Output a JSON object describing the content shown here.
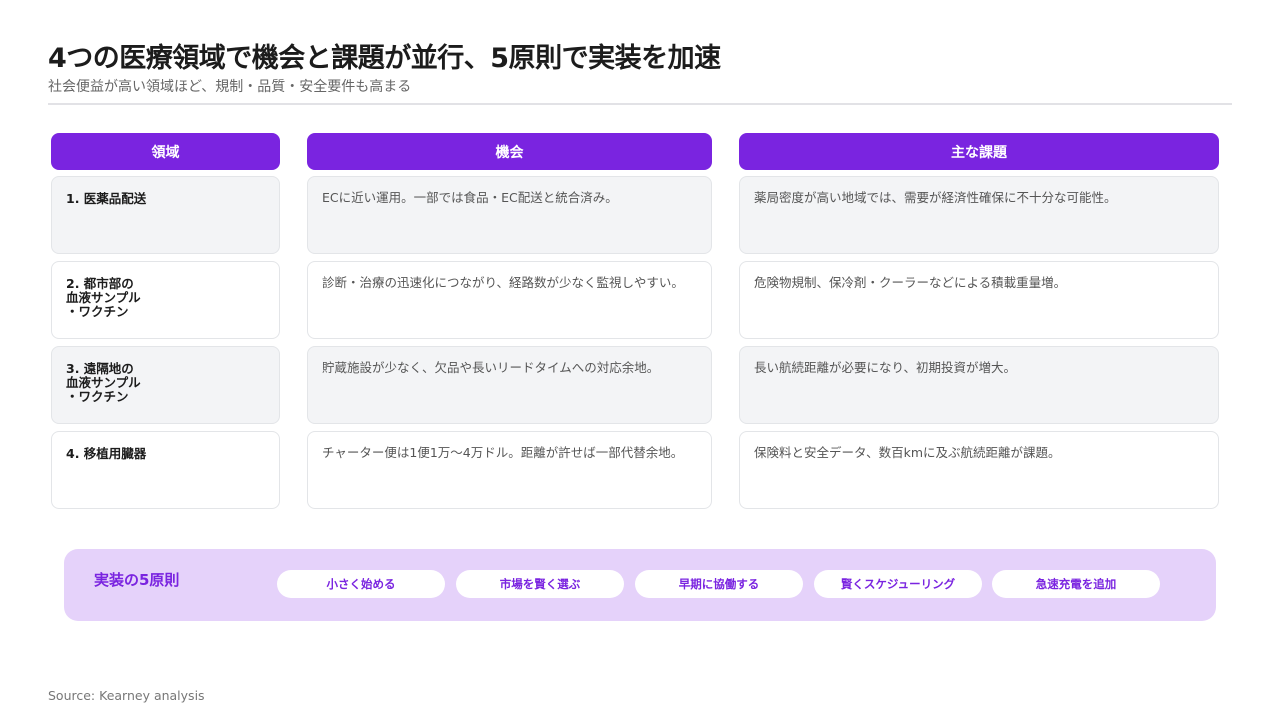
{
  "header": {
    "title": "4つの医療領域で機会と課題が並行、5原則で実装を加速",
    "subtitle": "社会便益が高い領域ほど、規制・品質・安全要件も高まる"
  },
  "table": {
    "headers": [
      "領域",
      "機会",
      "主な課題"
    ],
    "rows": [
      {
        "domain": "1. 医薬品配送",
        "opportunity": "ECに近い運用。一部では食品・EC配送と統合済み。",
        "challenge": "薬局密度が高い地域では、需要が経済性確保に不十分な可能性。"
      },
      {
        "domain": "2. 都市部の\n血液サンプル\n・ワクチン",
        "opportunity": "診断・治療の迅速化につながり、経路数が少なく監視しやすい。",
        "challenge": "危険物規制、保冷剤・クーラーなどによる積載重量増。"
      },
      {
        "domain": "3. 遠隔地の\n血液サンプル\n・ワクチン",
        "opportunity": "貯蔵施設が少なく、欠品や長いリードタイムへの対応余地。",
        "challenge": "長い航続距離が必要になり、初期投資が増大。"
      },
      {
        "domain": "4. 移植用臓器",
        "opportunity": "チャーター便は1便1万～4万ドル。距離が許せば一部代替余地。",
        "challenge": "保険料と安全データ、数百kmに及ぶ航続距離が課題。"
      }
    ]
  },
  "principles": {
    "title": "実装の5原則",
    "items": [
      "小さく始める",
      "市場を賢く選ぶ",
      "早期に協働する",
      "賢くスケジューリング",
      "急速充電を追加"
    ]
  },
  "footer": {
    "source": "Source: Kearney analysis"
  },
  "colors": {
    "accent": "#7a24e0",
    "principles_bg": "#e5d2fa"
  }
}
